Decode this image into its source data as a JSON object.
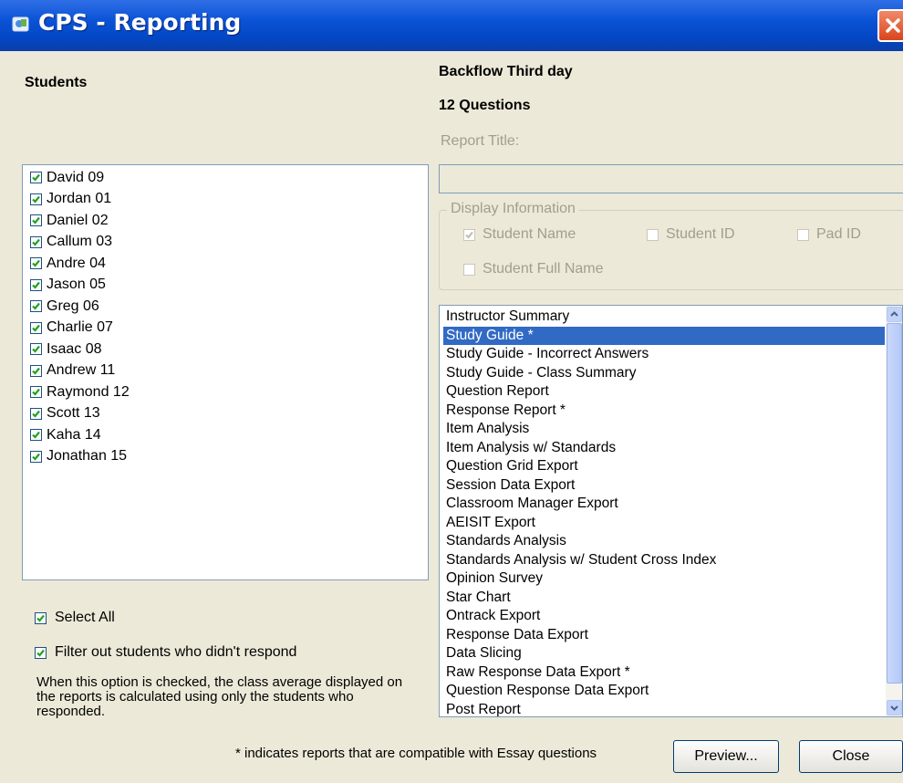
{
  "window": {
    "title": "CPS - Reporting"
  },
  "students_panel": {
    "heading": "Students",
    "students": [
      {
        "name": "David 09",
        "checked": true
      },
      {
        "name": "Jordan 01",
        "checked": true
      },
      {
        "name": "Daniel 02",
        "checked": true
      },
      {
        "name": "Callum 03",
        "checked": true
      },
      {
        "name": "Andre 04",
        "checked": true
      },
      {
        "name": "Jason 05",
        "checked": true
      },
      {
        "name": "Greg 06",
        "checked": true
      },
      {
        "name": "Charlie 07",
        "checked": true
      },
      {
        "name": "Isaac 08",
        "checked": true
      },
      {
        "name": "Andrew 11",
        "checked": true
      },
      {
        "name": "Raymond 12",
        "checked": true
      },
      {
        "name": "Scott 13",
        "checked": true
      },
      {
        "name": "Kaha 14",
        "checked": true
      },
      {
        "name": "Jonathan 15",
        "checked": true
      }
    ],
    "select_all_label": "Select All",
    "select_all_checked": true,
    "filter_label": "Filter out students who didn't respond",
    "filter_checked": true,
    "filter_note": "When this option is checked, the class average displayed on the reports is calculated using only the students who responded."
  },
  "session": {
    "name": "Backflow Third day",
    "question_count": "12 Questions",
    "report_title_label": "Report Title:",
    "report_title_value": ""
  },
  "display_information": {
    "legend": "Display Information",
    "student_name": {
      "label": "Student Name",
      "checked": true
    },
    "student_id": {
      "label": "Student ID",
      "checked": false
    },
    "pad_id": {
      "label": "Pad ID",
      "checked": false
    },
    "student_full_name": {
      "label": "Student Full Name",
      "checked": false
    }
  },
  "reports": {
    "selected": "Study Guide *",
    "items": [
      "Instructor Summary",
      "Study Guide *",
      "Study Guide - Incorrect Answers",
      "Study Guide - Class Summary",
      "Question Report",
      "Response Report *",
      "Item Analysis",
      "Item Analysis w/ Standards",
      "Question Grid Export",
      "Session Data Export",
      "Classroom Manager Export",
      "AEISIT Export",
      "Standards Analysis",
      "Standards Analysis w/ Student Cross Index",
      "Opinion Survey",
      "Star Chart",
      "Ontrack Export",
      "Response Data Export",
      "Data Slicing",
      "Raw Response Data Export *",
      "Question Response Data Export",
      "Post Report"
    ],
    "footnote": "* indicates reports that are compatible with Essay questions"
  },
  "buttons": {
    "preview": "Preview...",
    "close": "Close"
  },
  "colors": {
    "titlebar": "#0a53d6",
    "selection": "#316ac5",
    "window_bg": "#ece9d8"
  }
}
